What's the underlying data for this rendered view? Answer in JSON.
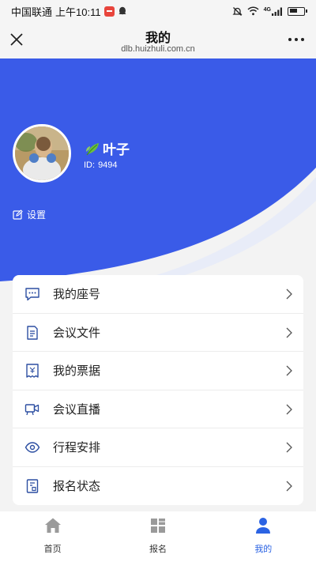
{
  "status_bar": {
    "carrier": "中国联通",
    "time": "上午10:11",
    "network": "4G"
  },
  "nav": {
    "title": "我的",
    "url": "dlb.huizhuli.com.cn"
  },
  "profile": {
    "name": "叶子",
    "id_label": "ID:",
    "id_value": "9494",
    "settings_label": "设置"
  },
  "menu": [
    {
      "label": "我的座号",
      "icon": "message-icon"
    },
    {
      "label": "会议文件",
      "icon": "document-icon"
    },
    {
      "label": "我的票据",
      "icon": "ticket-icon"
    },
    {
      "label": "会议直播",
      "icon": "video-icon"
    },
    {
      "label": "行程安排",
      "icon": "eye-icon"
    },
    {
      "label": "报名状态",
      "icon": "form-icon"
    }
  ],
  "tabs": [
    {
      "label": "首页",
      "icon": "home-icon",
      "active": false
    },
    {
      "label": "报名",
      "icon": "grid-icon",
      "active": false
    },
    {
      "label": "我的",
      "icon": "user-icon",
      "active": true
    }
  ],
  "colors": {
    "brand": "#3a5be8",
    "active_tab": "#2b63e3",
    "menu_icon": "#2d4fa2",
    "tab_inactive": "#9a9a9a"
  }
}
